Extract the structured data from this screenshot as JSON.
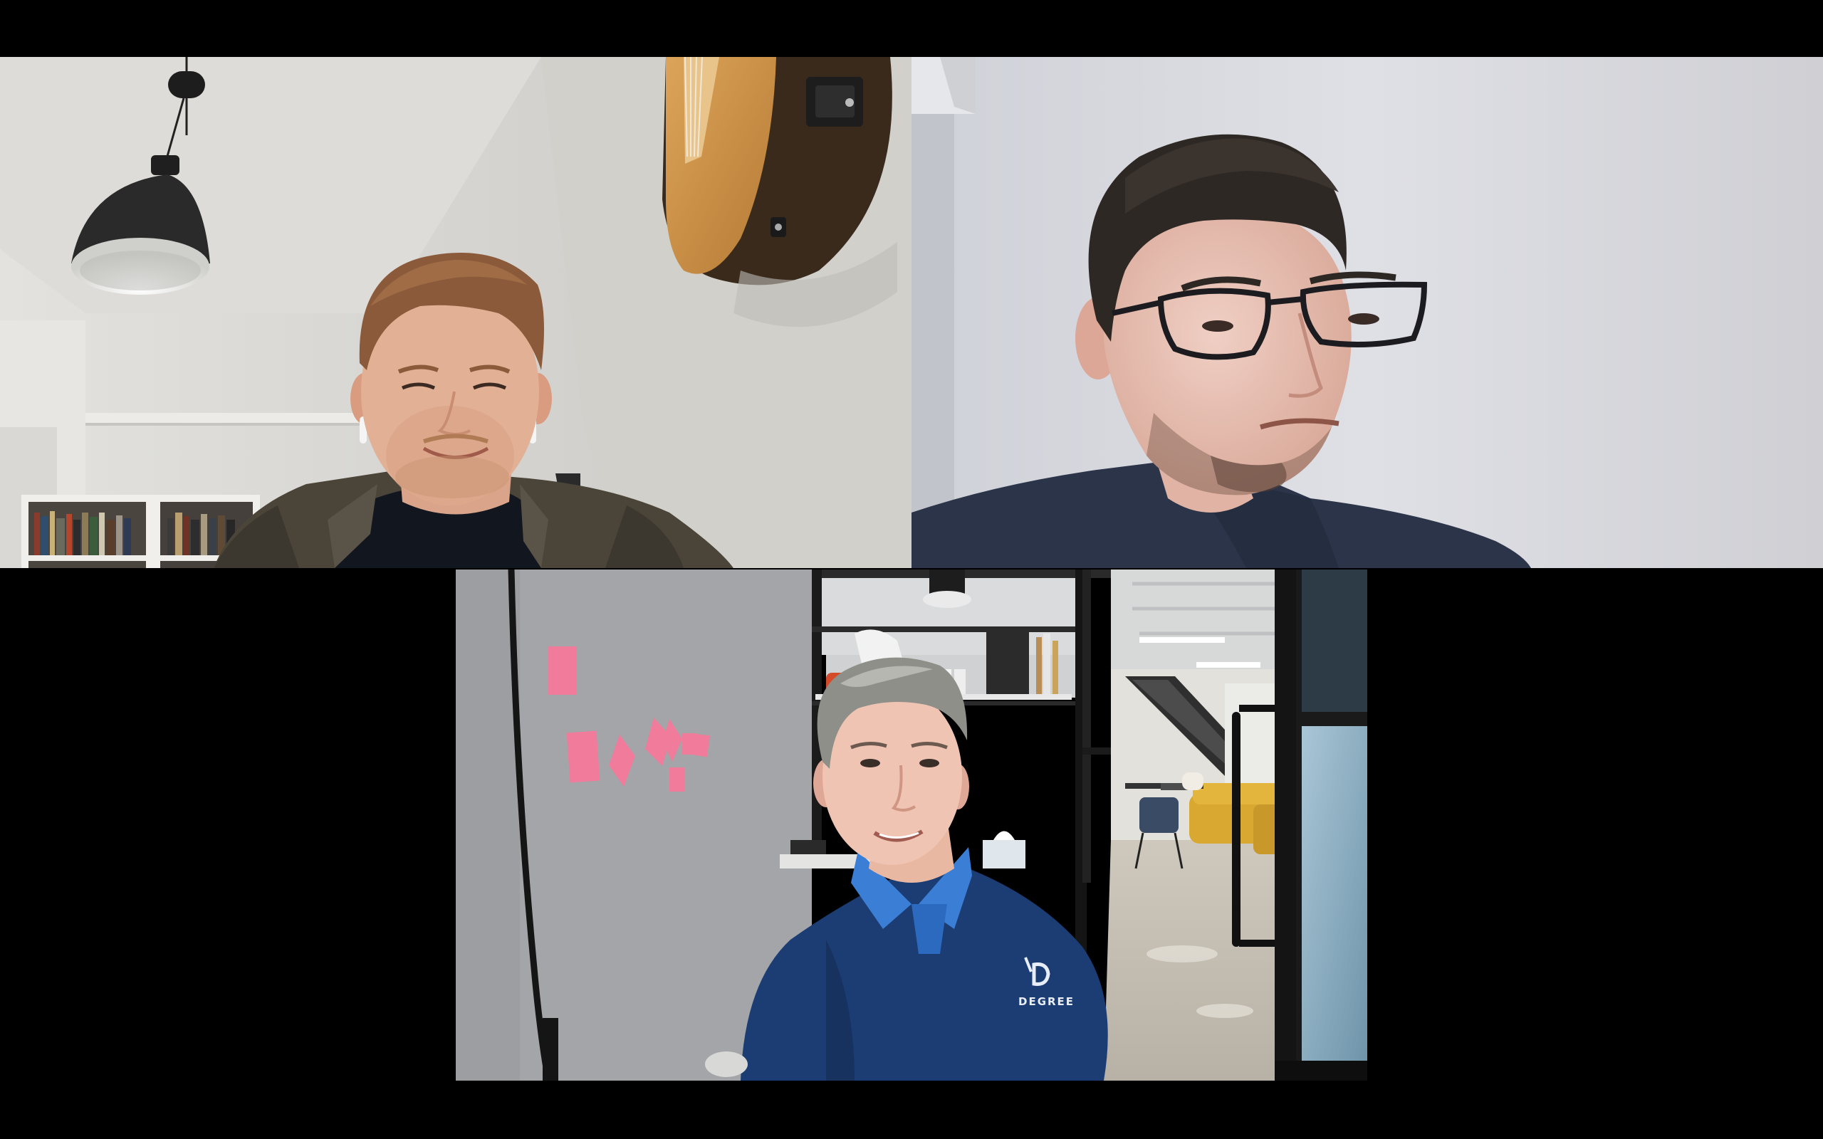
{
  "meeting": {
    "view": "gallery",
    "participants": [
      {
        "tile": "top-left",
        "label": ""
      },
      {
        "tile": "top-right",
        "label": ""
      },
      {
        "tile": "bottom-center",
        "label": "",
        "shirt_logo_text": "DEGREE"
      }
    ]
  },
  "colors": {
    "background": "#000000",
    "tile_left_wall": "#d7d6d2",
    "tile_right_wall": "#d9dadf",
    "tile_bottom_wall": "#a9a9ab",
    "sticky_notes": "#f07b9a",
    "sofa": "#d9a830",
    "polo_shirt": "#1b3d73"
  }
}
